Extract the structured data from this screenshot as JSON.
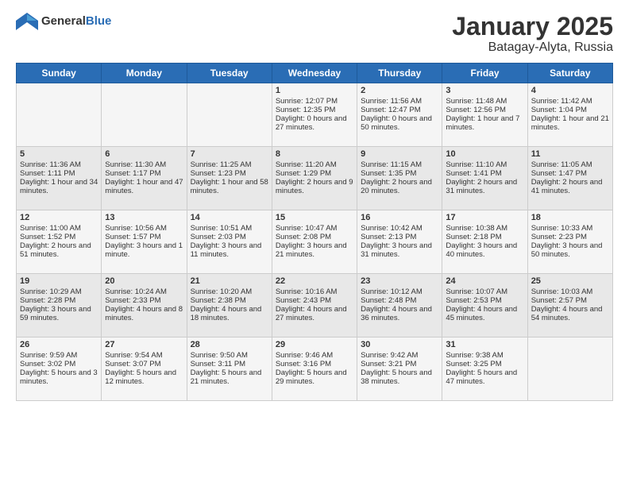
{
  "logo": {
    "text_general": "General",
    "text_blue": "Blue"
  },
  "title": "January 2025",
  "subtitle": "Batagay-Alyta, Russia",
  "days_of_week": [
    "Sunday",
    "Monday",
    "Tuesday",
    "Wednesday",
    "Thursday",
    "Friday",
    "Saturday"
  ],
  "weeks": [
    [
      {
        "day": "",
        "content": ""
      },
      {
        "day": "",
        "content": ""
      },
      {
        "day": "",
        "content": ""
      },
      {
        "day": "1",
        "content": "Sunrise: 12:07 PM\nSunset: 12:35 PM\nDaylight: 0 hours and 27 minutes."
      },
      {
        "day": "2",
        "content": "Sunrise: 11:56 AM\nSunset: 12:47 PM\nDaylight: 0 hours and 50 minutes."
      },
      {
        "day": "3",
        "content": "Sunrise: 11:48 AM\nSunset: 12:56 PM\nDaylight: 1 hour and 7 minutes."
      },
      {
        "day": "4",
        "content": "Sunrise: 11:42 AM\nSunset: 1:04 PM\nDaylight: 1 hour and 21 minutes."
      }
    ],
    [
      {
        "day": "5",
        "content": "Sunrise: 11:36 AM\nSunset: 1:11 PM\nDaylight: 1 hour and 34 minutes."
      },
      {
        "day": "6",
        "content": "Sunrise: 11:30 AM\nSunset: 1:17 PM\nDaylight: 1 hour and 47 minutes."
      },
      {
        "day": "7",
        "content": "Sunrise: 11:25 AM\nSunset: 1:23 PM\nDaylight: 1 hour and 58 minutes."
      },
      {
        "day": "8",
        "content": "Sunrise: 11:20 AM\nSunset: 1:29 PM\nDaylight: 2 hours and 9 minutes."
      },
      {
        "day": "9",
        "content": "Sunrise: 11:15 AM\nSunset: 1:35 PM\nDaylight: 2 hours and 20 minutes."
      },
      {
        "day": "10",
        "content": "Sunrise: 11:10 AM\nSunset: 1:41 PM\nDaylight: 2 hours and 31 minutes."
      },
      {
        "day": "11",
        "content": "Sunrise: 11:05 AM\nSunset: 1:47 PM\nDaylight: 2 hours and 41 minutes."
      }
    ],
    [
      {
        "day": "12",
        "content": "Sunrise: 11:00 AM\nSunset: 1:52 PM\nDaylight: 2 hours and 51 minutes."
      },
      {
        "day": "13",
        "content": "Sunrise: 10:56 AM\nSunset: 1:57 PM\nDaylight: 3 hours and 1 minute."
      },
      {
        "day": "14",
        "content": "Sunrise: 10:51 AM\nSunset: 2:03 PM\nDaylight: 3 hours and 11 minutes."
      },
      {
        "day": "15",
        "content": "Sunrise: 10:47 AM\nSunset: 2:08 PM\nDaylight: 3 hours and 21 minutes."
      },
      {
        "day": "16",
        "content": "Sunrise: 10:42 AM\nSunset: 2:13 PM\nDaylight: 3 hours and 31 minutes."
      },
      {
        "day": "17",
        "content": "Sunrise: 10:38 AM\nSunset: 2:18 PM\nDaylight: 3 hours and 40 minutes."
      },
      {
        "day": "18",
        "content": "Sunrise: 10:33 AM\nSunset: 2:23 PM\nDaylight: 3 hours and 50 minutes."
      }
    ],
    [
      {
        "day": "19",
        "content": "Sunrise: 10:29 AM\nSunset: 2:28 PM\nDaylight: 3 hours and 59 minutes."
      },
      {
        "day": "20",
        "content": "Sunrise: 10:24 AM\nSunset: 2:33 PM\nDaylight: 4 hours and 8 minutes."
      },
      {
        "day": "21",
        "content": "Sunrise: 10:20 AM\nSunset: 2:38 PM\nDaylight: 4 hours and 18 minutes."
      },
      {
        "day": "22",
        "content": "Sunrise: 10:16 AM\nSunset: 2:43 PM\nDaylight: 4 hours and 27 minutes."
      },
      {
        "day": "23",
        "content": "Sunrise: 10:12 AM\nSunset: 2:48 PM\nDaylight: 4 hours and 36 minutes."
      },
      {
        "day": "24",
        "content": "Sunrise: 10:07 AM\nSunset: 2:53 PM\nDaylight: 4 hours and 45 minutes."
      },
      {
        "day": "25",
        "content": "Sunrise: 10:03 AM\nSunset: 2:57 PM\nDaylight: 4 hours and 54 minutes."
      }
    ],
    [
      {
        "day": "26",
        "content": "Sunrise: 9:59 AM\nSunset: 3:02 PM\nDaylight: 5 hours and 3 minutes."
      },
      {
        "day": "27",
        "content": "Sunrise: 9:54 AM\nSunset: 3:07 PM\nDaylight: 5 hours and 12 minutes."
      },
      {
        "day": "28",
        "content": "Sunrise: 9:50 AM\nSunset: 3:11 PM\nDaylight: 5 hours and 21 minutes."
      },
      {
        "day": "29",
        "content": "Sunrise: 9:46 AM\nSunset: 3:16 PM\nDaylight: 5 hours and 29 minutes."
      },
      {
        "day": "30",
        "content": "Sunrise: 9:42 AM\nSunset: 3:21 PM\nDaylight: 5 hours and 38 minutes."
      },
      {
        "day": "31",
        "content": "Sunrise: 9:38 AM\nSunset: 3:25 PM\nDaylight: 5 hours and 47 minutes."
      },
      {
        "day": "",
        "content": ""
      }
    ]
  ]
}
